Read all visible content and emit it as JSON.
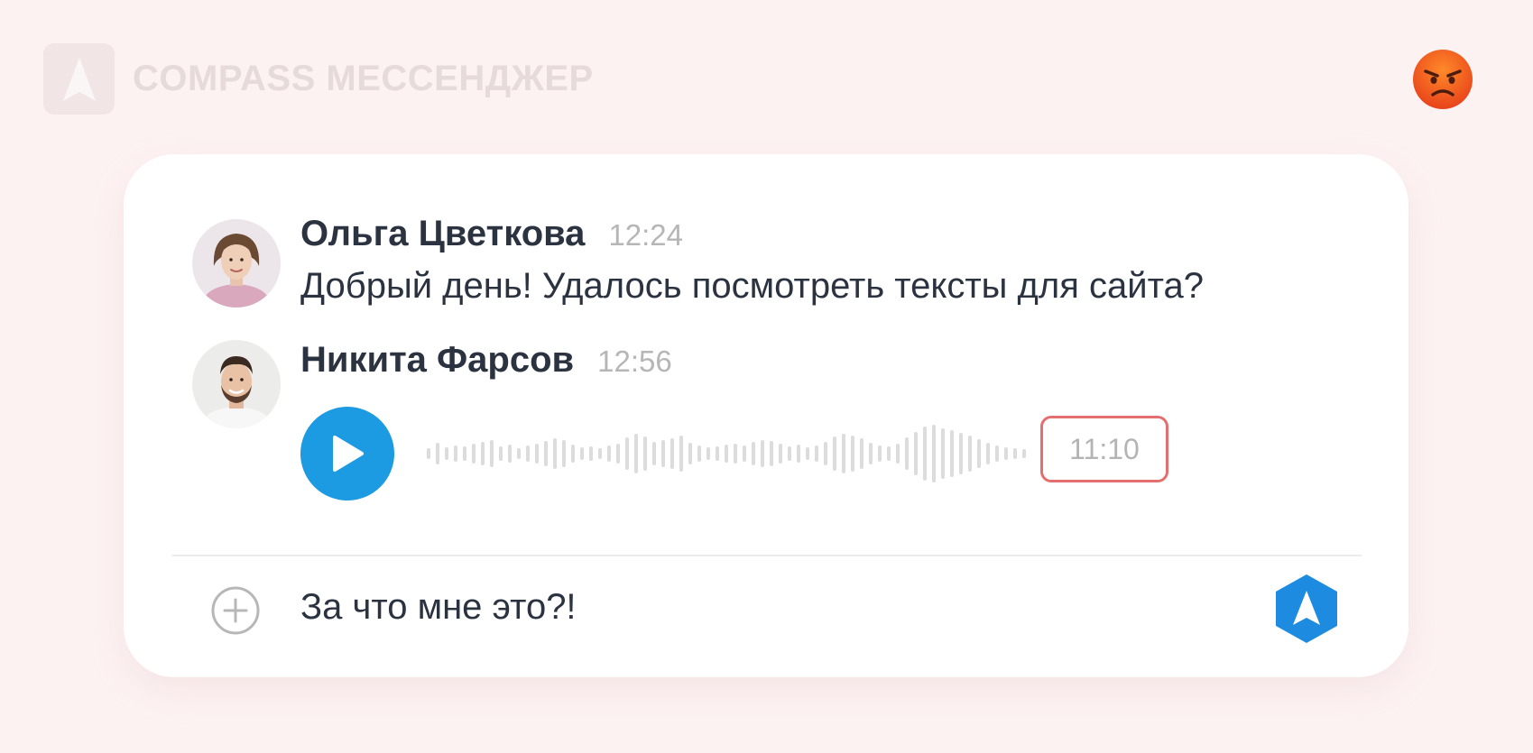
{
  "app": {
    "name": "COMPASS МЕССЕНДЖЕР",
    "status_emoji": "angry-face-icon"
  },
  "messages": [
    {
      "author": "Ольга Цветкова",
      "time": "12:24",
      "text": "Добрый день! Удалось посмотреть тексты для сайта?",
      "avatar": "avatar-woman"
    },
    {
      "author": "Никита Фарсов",
      "time": "12:56",
      "type": "voice",
      "duration": "11:10",
      "avatar": "avatar-man"
    }
  ],
  "composer": {
    "value": "За что мне это?!",
    "add_icon": "plus-circle-icon",
    "send_icon": "compass-send-icon"
  },
  "colors": {
    "accent": "#1c9be3",
    "highlight_border": "#e46f6f",
    "background": "#fdf2f2"
  }
}
